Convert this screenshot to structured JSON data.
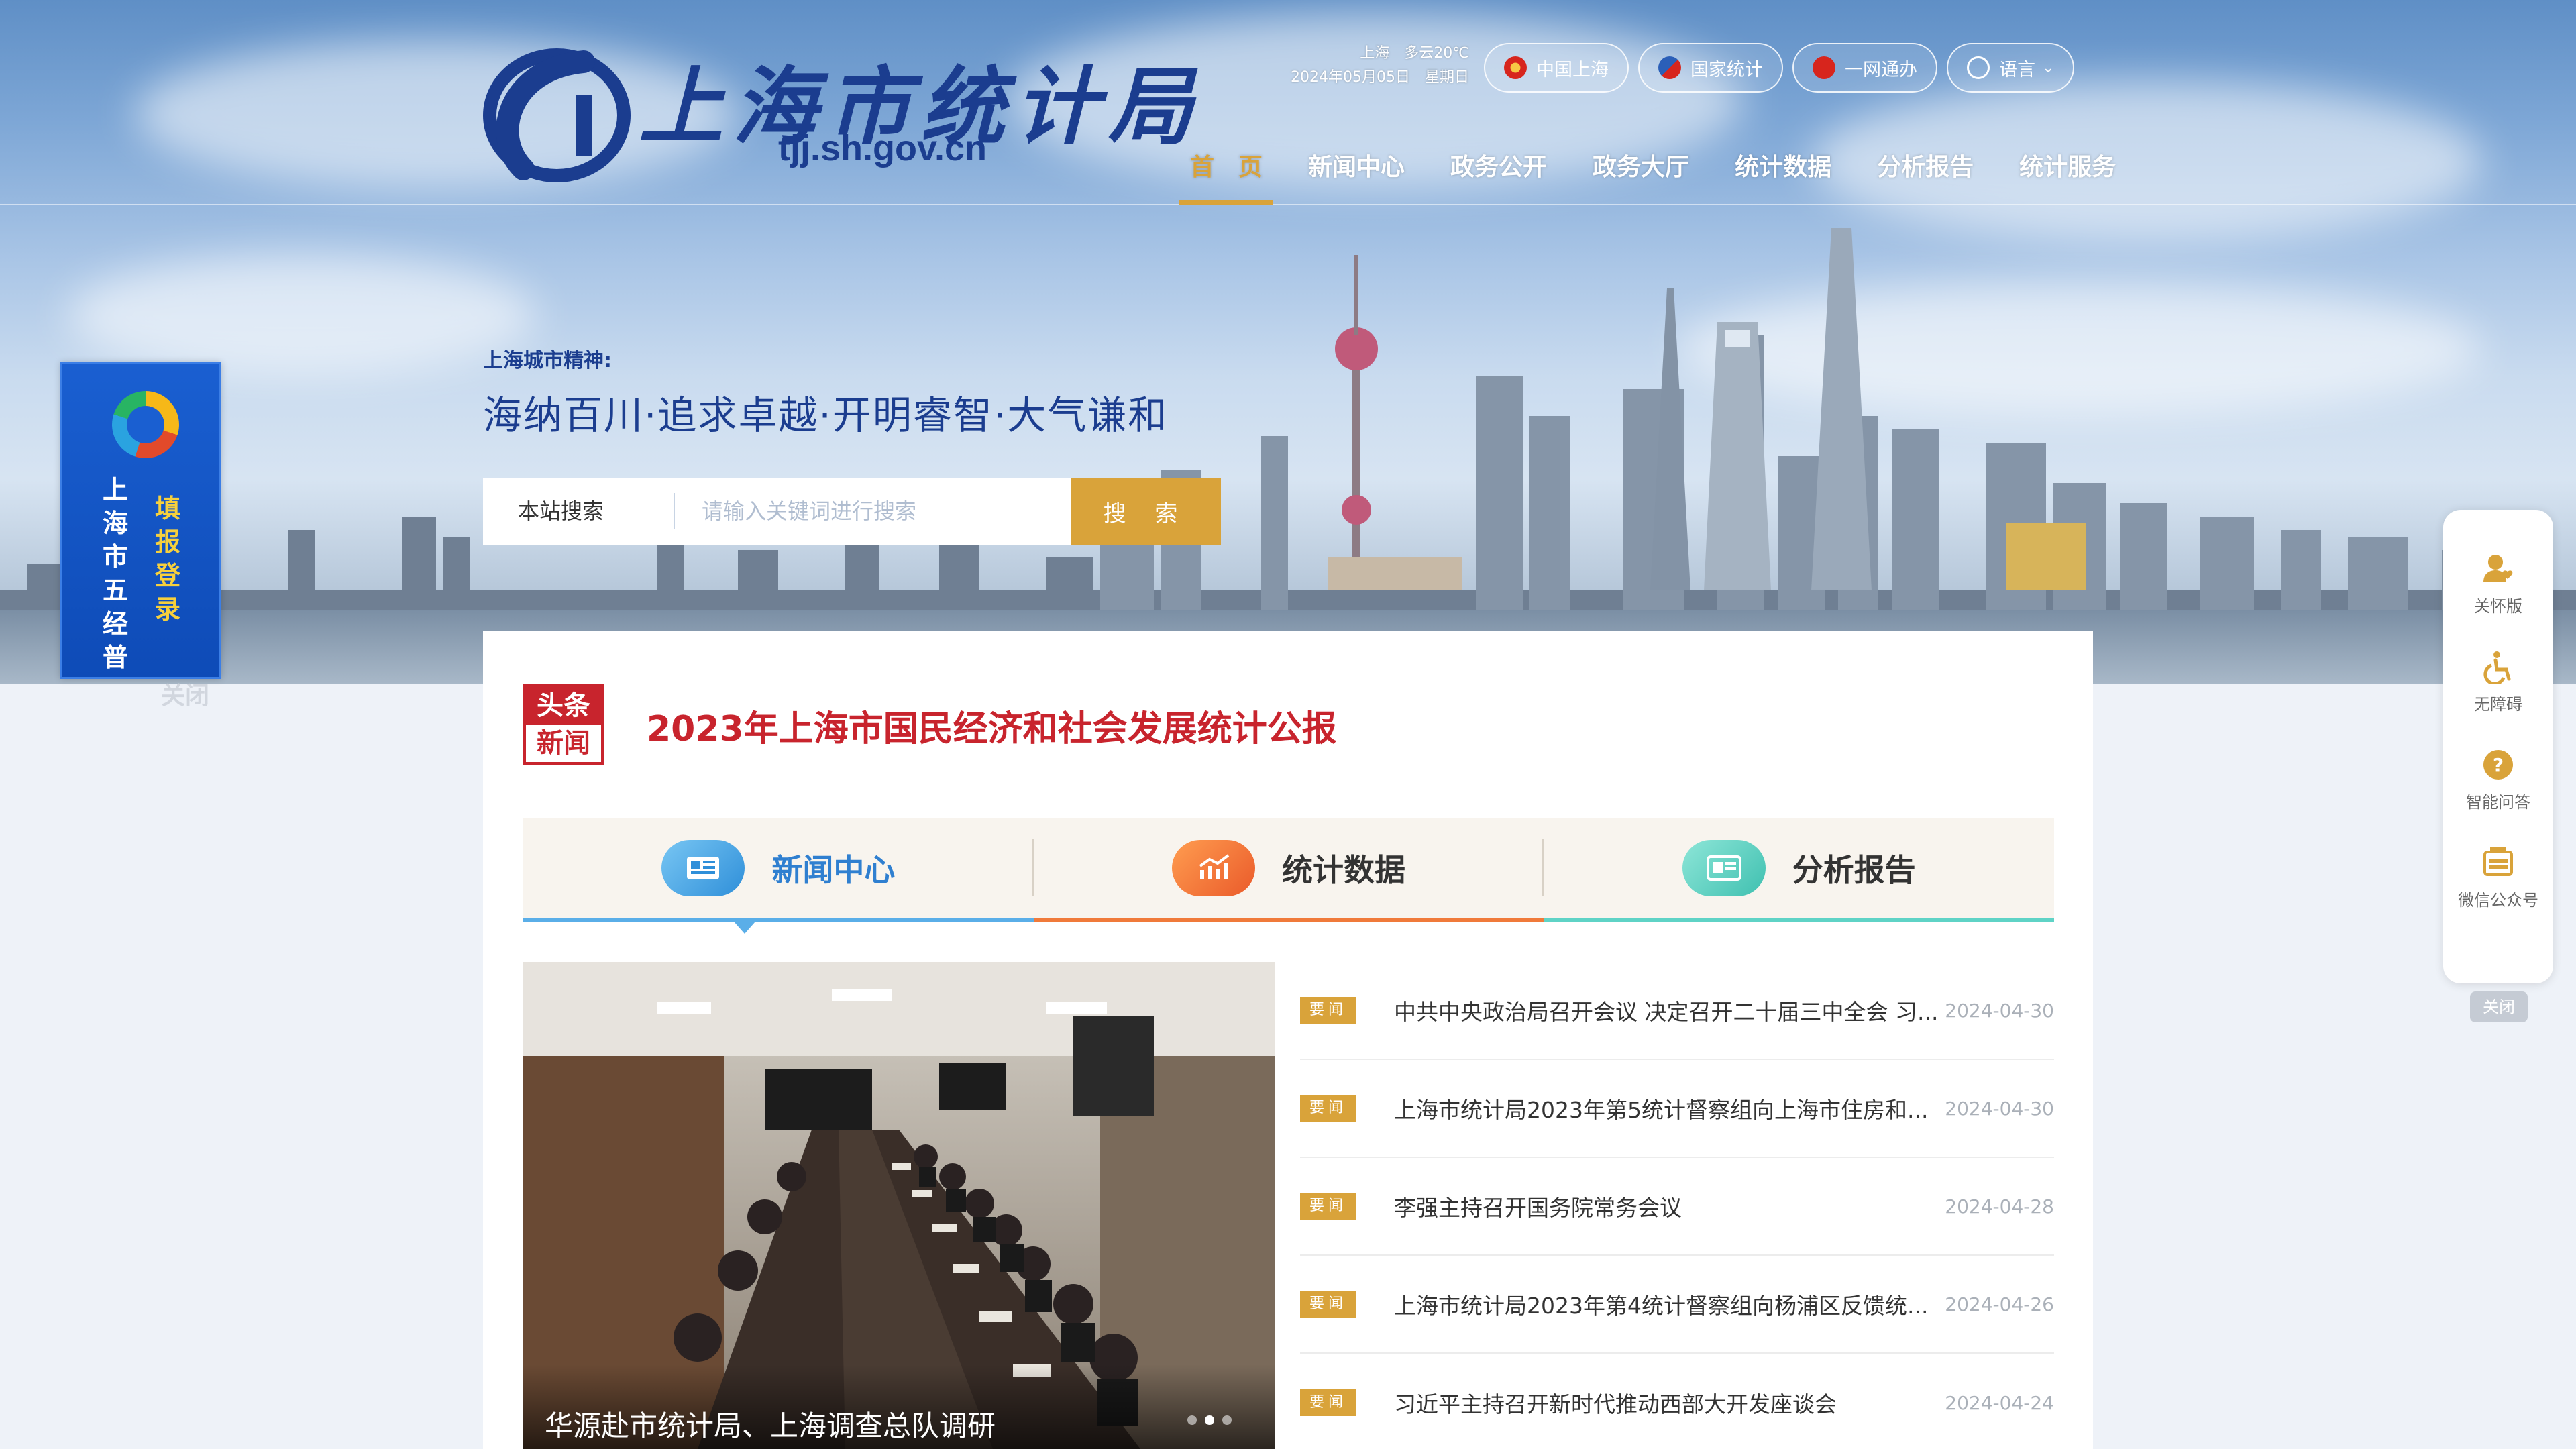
{
  "header": {
    "logo_title": "上海市统计局",
    "logo_url": "tjj.sh.gov.cn",
    "weather_line1": "上海　多云20℃",
    "weather_line2": "2024年05月05日　星期日",
    "top_buttons": [
      {
        "label": "中国上海",
        "icon": "shanghai-emblem-icon"
      },
      {
        "label": "国家统计",
        "icon": "national-stats-icon"
      },
      {
        "label": "一网通办",
        "icon": "one-net-icon"
      },
      {
        "label": "语言",
        "icon": "globe-icon"
      }
    ],
    "nav": [
      {
        "label": "首　页",
        "active": true
      },
      {
        "label": "新闻中心"
      },
      {
        "label": "政务公开"
      },
      {
        "label": "政务大厅"
      },
      {
        "label": "统计数据"
      },
      {
        "label": "分析报告"
      },
      {
        "label": "统计服务"
      }
    ]
  },
  "banner": {
    "spirit_label": "上海城市精神:",
    "spirit_text": "海纳百川·追求卓越·开明睿智·大气谦和"
  },
  "search": {
    "scope": "本站搜索",
    "placeholder": "请输入关键词进行搜索",
    "button": "搜 索"
  },
  "left_ad": {
    "col1": "上海市五经普",
    "col2": "填报登录",
    "close": "关闭"
  },
  "right_bar": {
    "items": [
      {
        "label": "关怀版",
        "icon": "care-user-icon"
      },
      {
        "label": "无障碍",
        "icon": "accessibility-icon"
      },
      {
        "label": "智能问答",
        "icon": "question-icon"
      },
      {
        "label": "微信公众号",
        "icon": "wechat-account-icon"
      }
    ],
    "close": "关闭"
  },
  "headline": {
    "badge_top": "头条",
    "badge_bottom": "新闻",
    "title": "2023年上海市国民经济和社会发展统计公报"
  },
  "tabs": [
    {
      "label": "新闻中心",
      "icon": "newspaper-icon",
      "active": true
    },
    {
      "label": "统计数据",
      "icon": "chart-trend-icon"
    },
    {
      "label": "分析报告",
      "icon": "report-icon"
    }
  ],
  "feature": {
    "caption": "华源赴市统计局、上海调查总队调研",
    "slides": 3,
    "active_slide": 2
  },
  "news": [
    {
      "tag": "要闻",
      "title": "中共中央政治局召开会议 决定召开二十届三中全会 习...",
      "date": "2024-04-30"
    },
    {
      "tag": "要闻",
      "title": "上海市统计局2023年第5统计督察组向上海市住房和...",
      "date": "2024-04-30"
    },
    {
      "tag": "要闻",
      "title": "李强主持召开国务院常务会议",
      "date": "2024-04-28"
    },
    {
      "tag": "要闻",
      "title": "上海市统计局2023年第4统计督察组向杨浦区反馈统...",
      "date": "2024-04-26"
    },
    {
      "tag": "要闻",
      "title": "习近平主持召开新时代推动西部大开发座谈会",
      "date": "2024-04-24"
    }
  ],
  "colors": {
    "brand_blue": "#1b3d8f",
    "accent_gold": "#d9a33a",
    "headline_red": "#c8242d"
  }
}
